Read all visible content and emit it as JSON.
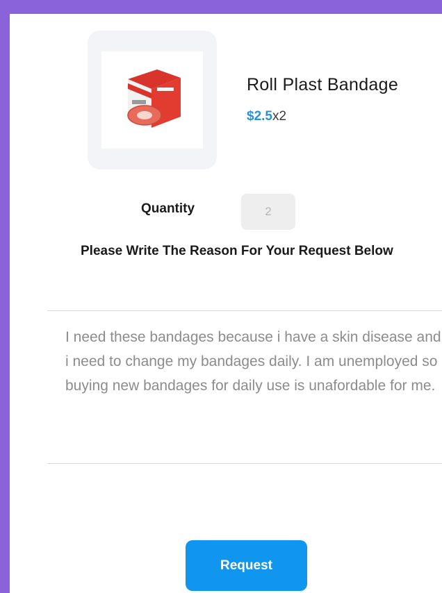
{
  "product": {
    "name": "Roll Plast Bandage",
    "price": "$2.5",
    "multiplier": "x2",
    "image_icon": "bandage-box-image"
  },
  "quantity": {
    "label": "Quantity",
    "value": "2"
  },
  "reason": {
    "prompt": "Please Write The Reason For Your Request Below",
    "text": "I need these bandages because i have a skin disease and i need to change my bandages daily. I am unemployed so buying new bandages for daily use is unafordable for me."
  },
  "actions": {
    "request_label": "Request"
  },
  "colors": {
    "background": "#8a62d9",
    "accent": "#1196ef",
    "price": "#2d8fd9"
  }
}
